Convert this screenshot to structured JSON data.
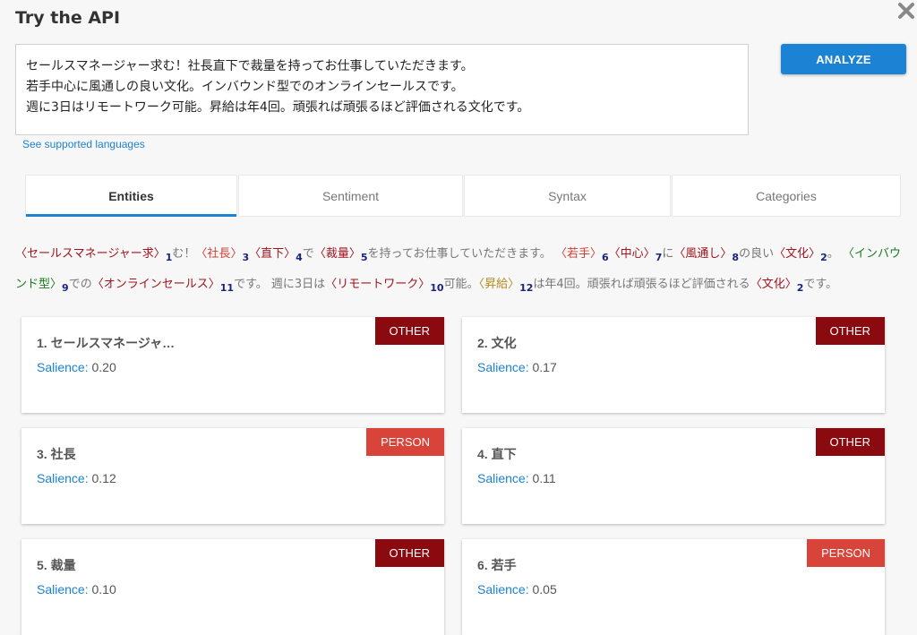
{
  "title": "Try the API",
  "input_text": "セールスマネージャー求む！社長直下で裁量を持ってお仕事していただきます。\n若手中心に風通しの良い文化。インバウンド型でのオンラインセールスです。\n週に3日はリモートワーク可能。昇給は年4回。頑張れば頑張るほど評価される文化です。",
  "analyze_label": "ANALYZE",
  "languages_link": "See supported languages",
  "tabs": [
    "Entities",
    "Sentiment",
    "Syntax",
    "Categories"
  ],
  "annotated_text": [
    {
      "t": "〈",
      "e": false
    },
    {
      "t": "セールスマネージャー求",
      "e": true,
      "c": "c-other"
    },
    {
      "t": "〉",
      "e": false
    },
    {
      "t": "1",
      "s": true
    },
    {
      "t": "む！",
      "e": false
    },
    {
      "t": "〈",
      "e": false
    },
    {
      "t": "社長",
      "e": true,
      "c": "c-person"
    },
    {
      "t": "〉",
      "e": false
    },
    {
      "t": "3",
      "s": true
    },
    {
      "t": "〈",
      "e": false
    },
    {
      "t": "直下",
      "e": true,
      "c": "c-other"
    },
    {
      "t": "〉",
      "e": false
    },
    {
      "t": "4",
      "s": true
    },
    {
      "t": "で",
      "e": false
    },
    {
      "t": "〈",
      "e": false
    },
    {
      "t": "裁量",
      "e": true,
      "c": "c-other"
    },
    {
      "t": "〉",
      "e": false
    },
    {
      "t": "5",
      "s": true
    },
    {
      "t": "を持ってお仕事していただきます。 ",
      "e": false
    },
    {
      "t": "〈",
      "e": false
    },
    {
      "t": "若手",
      "e": true,
      "c": "c-person"
    },
    {
      "t": "〉",
      "e": false
    },
    {
      "t": "6",
      "s": true
    },
    {
      "t": "〈",
      "e": false
    },
    {
      "t": "中心",
      "e": true,
      "c": "c-other"
    },
    {
      "t": "〉",
      "e": false
    },
    {
      "t": "7",
      "s": true
    },
    {
      "t": "に",
      "e": false
    },
    {
      "t": "〈",
      "e": false
    },
    {
      "t": "風通し",
      "e": true,
      "c": "c-other"
    },
    {
      "t": "〉",
      "e": false
    },
    {
      "t": "8",
      "s": true
    },
    {
      "t": "の良い",
      "e": false
    },
    {
      "t": "〈",
      "e": false
    },
    {
      "t": "文化",
      "e": true,
      "c": "c-other"
    },
    {
      "t": "〉",
      "e": false
    },
    {
      "t": "2",
      "s": true
    },
    {
      "t": "。 ",
      "e": false
    },
    {
      "t": "〈",
      "e": false
    },
    {
      "t": "インバウンド型",
      "e": true,
      "c": "c-loc"
    },
    {
      "t": "〉",
      "e": false
    },
    {
      "t": "9",
      "s": true
    },
    {
      "t": "での",
      "e": false
    },
    {
      "t": "〈",
      "e": false
    },
    {
      "t": "オンラインセールス",
      "e": true,
      "c": "c-other"
    },
    {
      "t": "〉",
      "e": false
    },
    {
      "t": "11",
      "s": true
    },
    {
      "t": "です。 週に3日は",
      "e": false
    },
    {
      "t": "〈",
      "e": false
    },
    {
      "t": "リモートワーク",
      "e": true,
      "c": "c-other"
    },
    {
      "t": "〉",
      "e": false
    },
    {
      "t": "10",
      "s": true
    },
    {
      "t": "可能。",
      "e": false
    },
    {
      "t": "〈",
      "e": false
    },
    {
      "t": "昇給",
      "e": true,
      "c": "c-event"
    },
    {
      "t": "〉",
      "e": false
    },
    {
      "t": "12",
      "s": true
    },
    {
      "t": "は年4回。頑張れば頑張るほど評価される",
      "e": false
    },
    {
      "t": "〈",
      "e": false
    },
    {
      "t": "文化",
      "e": true,
      "c": "c-other"
    },
    {
      "t": "〉",
      "e": false
    },
    {
      "t": "2",
      "s": true
    },
    {
      "t": "です。",
      "e": false
    }
  ],
  "salience_label": "Salience:",
  "entities": [
    {
      "name": "1. セールスマネージャ…",
      "salience": "0.20",
      "type": "OTHER"
    },
    {
      "name": "2. 文化",
      "salience": "0.17",
      "type": "OTHER"
    },
    {
      "name": "3. 社長",
      "salience": "0.12",
      "type": "PERSON"
    },
    {
      "name": "4. 直下",
      "salience": "0.11",
      "type": "OTHER"
    },
    {
      "name": "5. 裁量",
      "salience": "0.10",
      "type": "OTHER"
    },
    {
      "name": "6. 若手",
      "salience": "0.05",
      "type": "PERSON"
    }
  ],
  "colors": {
    "accent": "#1b82d4",
    "other_badge": "#8b0a10",
    "person_badge": "#d9443a"
  }
}
